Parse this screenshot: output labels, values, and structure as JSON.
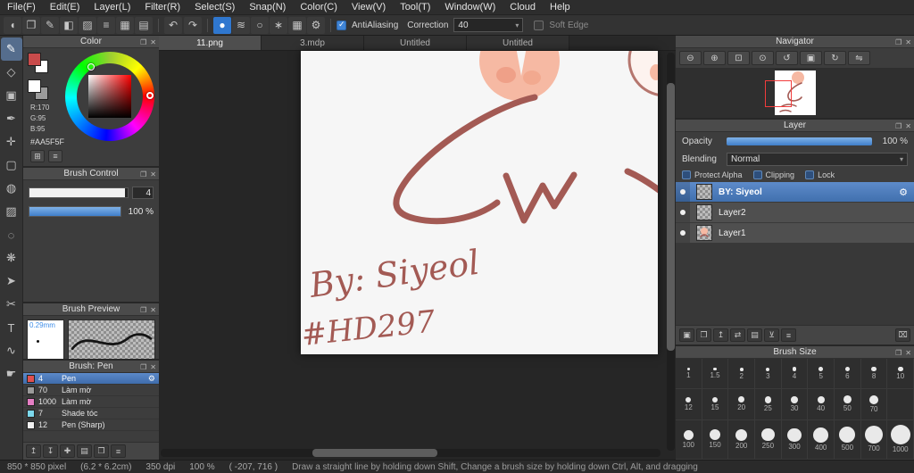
{
  "menu": {
    "items": [
      "File(F)",
      "Edit(E)",
      "Layer(L)",
      "Filter(R)",
      "Select(S)",
      "Snap(N)",
      "Color(C)",
      "View(V)",
      "Tool(T)",
      "Window(W)",
      "Cloud",
      "Help"
    ]
  },
  "toolbar": {
    "shortcut_icons": [
      {
        "name": "select-shape-icon",
        "glyph": "◖"
      },
      {
        "name": "clipboard-icon",
        "glyph": "❐"
      },
      {
        "name": "draw-mode-icon",
        "glyph": "✎"
      },
      {
        "name": "fill-mode-icon",
        "glyph": "◧"
      },
      {
        "name": "pattern-icon",
        "glyph": "▨"
      },
      {
        "name": "stack-icon",
        "glyph": "≡"
      },
      {
        "name": "grid-icon",
        "glyph": "▦"
      },
      {
        "name": "panel-layout-icon",
        "glyph": "▤"
      }
    ],
    "undo_icon": "↶",
    "redo_icon": "↷",
    "brush_mode_icons": [
      {
        "name": "brush-circle-icon",
        "glyph": "●",
        "selected": true
      },
      {
        "name": "brush-strokes-icon",
        "glyph": "≋"
      },
      {
        "name": "brush-ring-icon",
        "glyph": "○"
      },
      {
        "name": "brush-scatter-icon",
        "glyph": "∗"
      },
      {
        "name": "brush-grid-icon",
        "glyph": "▦"
      },
      {
        "name": "brush-settings-gear-icon",
        "glyph": "⚙"
      }
    ],
    "antialiasing_label": "AntiAliasing",
    "antialiasing_checked": true,
    "correction_label": "Correction",
    "correction_value": "40",
    "soft_edge_label": "Soft Edge",
    "soft_edge_checked": false
  },
  "tools": [
    {
      "name": "brush-tool",
      "glyph": "✎",
      "selected": true
    },
    {
      "name": "eraser-tool",
      "glyph": "◇"
    },
    {
      "name": "stamp-tool",
      "glyph": "▣"
    },
    {
      "name": "pen-tool",
      "glyph": "✒"
    },
    {
      "name": "move-tool",
      "glyph": "✛"
    },
    {
      "name": "rect-select-tool",
      "glyph": "▢"
    },
    {
      "name": "bucket-tool",
      "glyph": "◍"
    },
    {
      "name": "gradient-tool",
      "glyph": "▨"
    },
    {
      "name": "lasso-select-tool",
      "glyph": "◌"
    },
    {
      "name": "magic-wand-tool",
      "glyph": "❋"
    },
    {
      "name": "operation-tool",
      "glyph": "➤"
    },
    {
      "name": "divide-tool",
      "glyph": "✂"
    },
    {
      "name": "text-tool",
      "glyph": "T"
    },
    {
      "name": "curve-tool",
      "glyph": "∿"
    },
    {
      "name": "hand-tool",
      "glyph": "☛"
    }
  ],
  "color_panel": {
    "title": "Color",
    "r_label": "R:170",
    "g_label": "G:95",
    "b_label": "B:95",
    "hex": "#AA5F5F",
    "foreground_swatch": "#c94b4b",
    "background_swatch": "#ffffff"
  },
  "brush_control": {
    "title": "Brush Control",
    "size_value": "4",
    "opacity_value": "100 %"
  },
  "brush_preview": {
    "title": "Brush Preview",
    "size_label": "0.29mm"
  },
  "brush_panel": {
    "title": "Brush: Pen",
    "brushes": [
      {
        "size": "4",
        "name": "Pen",
        "swatch": "#e05050",
        "selected": true
      },
      {
        "size": "70",
        "name": "Làm mờ",
        "swatch": "#9a9a9a",
        "selected": false
      },
      {
        "size": "1000",
        "name": "Làm mờ",
        "swatch": "#e57ec4",
        "selected": false
      },
      {
        "size": "7",
        "name": "Shade tóc",
        "swatch": "#7cd8ec",
        "selected": false
      },
      {
        "size": "12",
        "name": "Pen (Sharp)",
        "swatch": "#f2f2f2",
        "selected": false
      }
    ],
    "footer_icons": [
      {
        "name": "brush-up-icon",
        "glyph": "↥"
      },
      {
        "name": "brush-down-icon",
        "glyph": "↧"
      },
      {
        "name": "add-brush-icon",
        "glyph": "✚"
      },
      {
        "name": "brush-folder-icon",
        "glyph": "▤"
      },
      {
        "name": "brush-duplicate-icon",
        "glyph": "❐"
      },
      {
        "name": "brush-menu-icon",
        "glyph": "≡"
      }
    ]
  },
  "canvas": {
    "tabs": [
      {
        "label": "11.png",
        "active": true
      },
      {
        "label": "3.mdp",
        "active": false
      },
      {
        "label": "Untitled",
        "active": false
      },
      {
        "label": "Untitled",
        "active": false
      }
    ],
    "signature_line1": "By: Siyeol",
    "signature_line2": "#HD297",
    "stroke_color": "#a35a54",
    "blob_color": "#f6b9a3"
  },
  "navigator": {
    "title": "Navigator",
    "icons": [
      {
        "name": "zoom-out-icon",
        "glyph": "⊖"
      },
      {
        "name": "zoom-in-icon",
        "glyph": "⊕"
      },
      {
        "name": "zoom-fit-icon",
        "glyph": "⊡"
      },
      {
        "name": "zoom-actual-icon",
        "glyph": "⊙"
      },
      {
        "name": "rotate-ccw-icon",
        "glyph": "↺"
      },
      {
        "name": "rotate-reset-icon",
        "glyph": "▣"
      },
      {
        "name": "rotate-cw-icon",
        "glyph": "↻"
      },
      {
        "name": "flip-horizontal-icon",
        "glyph": "⇋"
      }
    ]
  },
  "layer_panel": {
    "title": "Layer",
    "opacity_label": "Opacity",
    "opacity_value": "100 %",
    "blending_label": "Blending",
    "blending_value": "Normal",
    "protect_alpha_label": "Protect Alpha",
    "clipping_label": "Clipping",
    "lock_label": "Lock",
    "layers": [
      {
        "name": "BY: Siyeol",
        "selected": true,
        "has_art": false
      },
      {
        "name": "Layer2",
        "selected": false,
        "has_art": false
      },
      {
        "name": "Layer1",
        "selected": false,
        "has_art": true
      }
    ],
    "footer_icons": [
      {
        "name": "new-layer-icon",
        "glyph": "▣"
      },
      {
        "name": "duplicate-layer-icon",
        "glyph": "❐"
      },
      {
        "name": "layer-up-icon",
        "glyph": "↥"
      },
      {
        "name": "layer-transfer-icon",
        "glyph": "⇄"
      },
      {
        "name": "layer-folder-icon",
        "glyph": "▤"
      },
      {
        "name": "merge-layer-icon",
        "glyph": "⊻"
      },
      {
        "name": "layer-settings-icon",
        "glyph": "≡"
      }
    ],
    "delete_icon": {
      "name": "delete-layer-icon",
      "glyph": "⌧"
    }
  },
  "brush_size_panel": {
    "title": "Brush Size",
    "rows": [
      [
        "1",
        "1.5",
        "2",
        "3",
        "4",
        "5",
        "6",
        "8",
        "10"
      ],
      [
        "12",
        "15",
        "20",
        "25",
        "30",
        "40",
        "50",
        "70"
      ],
      [
        "100",
        "150",
        "200",
        "250",
        "300",
        "400",
        "500",
        "700",
        "1000"
      ]
    ]
  },
  "status_bar": {
    "size": "850 * 850 pixel",
    "physical": "(6.2 * 6.2cm)",
    "dpi": "350 dpi",
    "zoom": "100 %",
    "coords": "( -207, 716 )",
    "hint": "Draw a straight line by holding down Shift, Change a brush size by holding down Ctrl, Alt, and dragging"
  }
}
